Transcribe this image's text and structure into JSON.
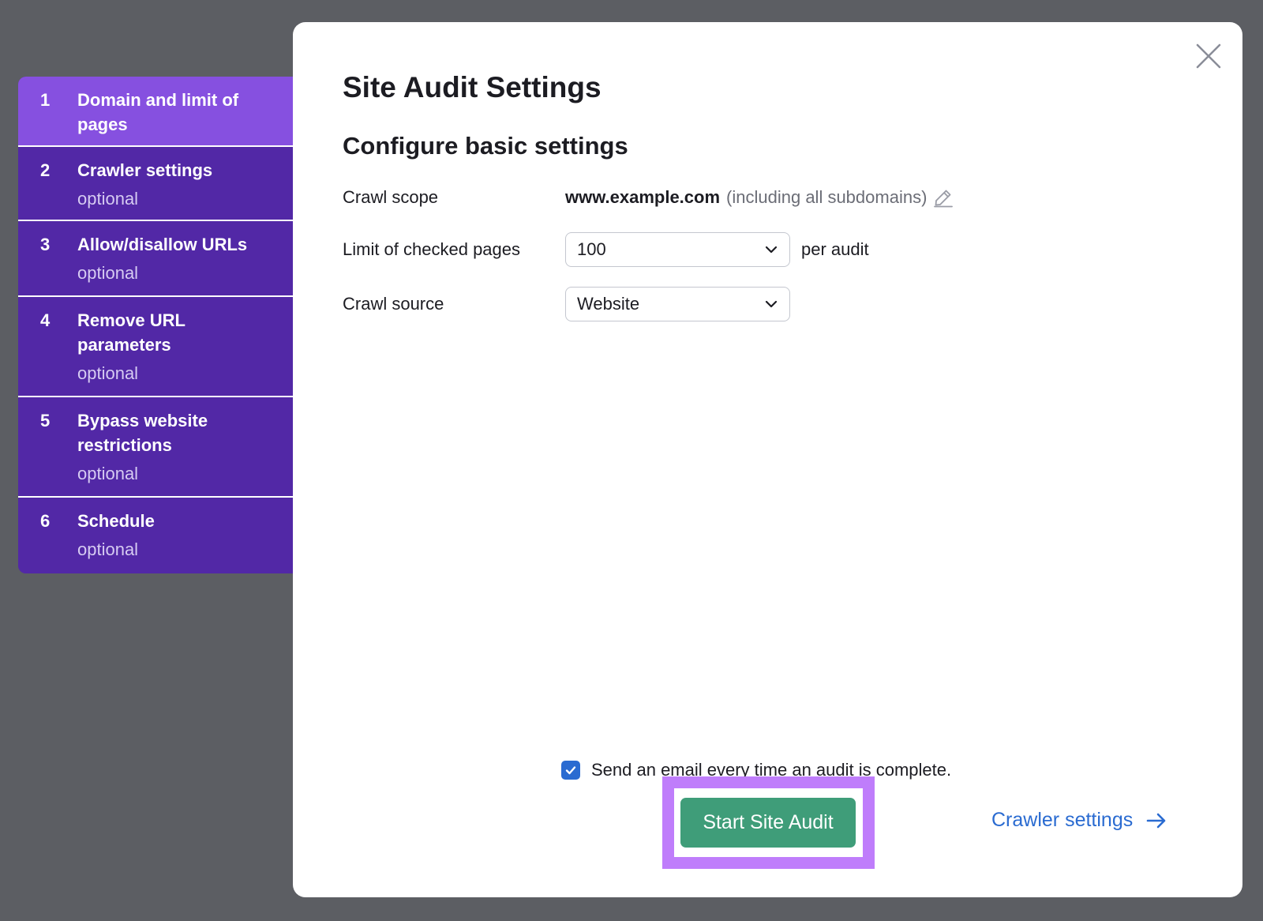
{
  "steps": [
    {
      "num": "1",
      "title": "Domain and limit of pages",
      "optional": "",
      "active": true
    },
    {
      "num": "2",
      "title": "Crawler settings",
      "optional": "optional",
      "active": false
    },
    {
      "num": "3",
      "title": "Allow/disallow URLs",
      "optional": "optional",
      "active": false
    },
    {
      "num": "4",
      "title": "Remove URL parameters",
      "optional": "optional",
      "active": false
    },
    {
      "num": "5",
      "title": "Bypass website restrictions",
      "optional": "optional",
      "active": false
    },
    {
      "num": "6",
      "title": "Schedule",
      "optional": "optional",
      "active": false
    }
  ],
  "modal": {
    "title": "Site Audit Settings",
    "subtitle": "Configure basic settings",
    "crawl_scope": {
      "label": "Crawl scope",
      "domain": "www.example.com",
      "note": "(including all subdomains)"
    },
    "limit": {
      "label": "Limit of checked pages",
      "value": "100",
      "suffix": "per audit"
    },
    "source": {
      "label": "Crawl source",
      "value": "Website"
    },
    "email_checkbox": {
      "label": "Send an email every time an audit is complete.",
      "checked": true
    },
    "start_button": "Start Site Audit",
    "next_link": "Crawler settings"
  },
  "icons": {
    "close": "close-icon",
    "edit": "pencil-icon",
    "dropdown": "chevron-down-icon",
    "check": "check-icon",
    "next": "arrow-right-icon"
  },
  "colors": {
    "step_active": "#8650e0",
    "step_inactive": "#5228a6",
    "primary_button": "#3f9d79",
    "link": "#2a6bd1",
    "highlight_border": "#bf7dfb"
  }
}
